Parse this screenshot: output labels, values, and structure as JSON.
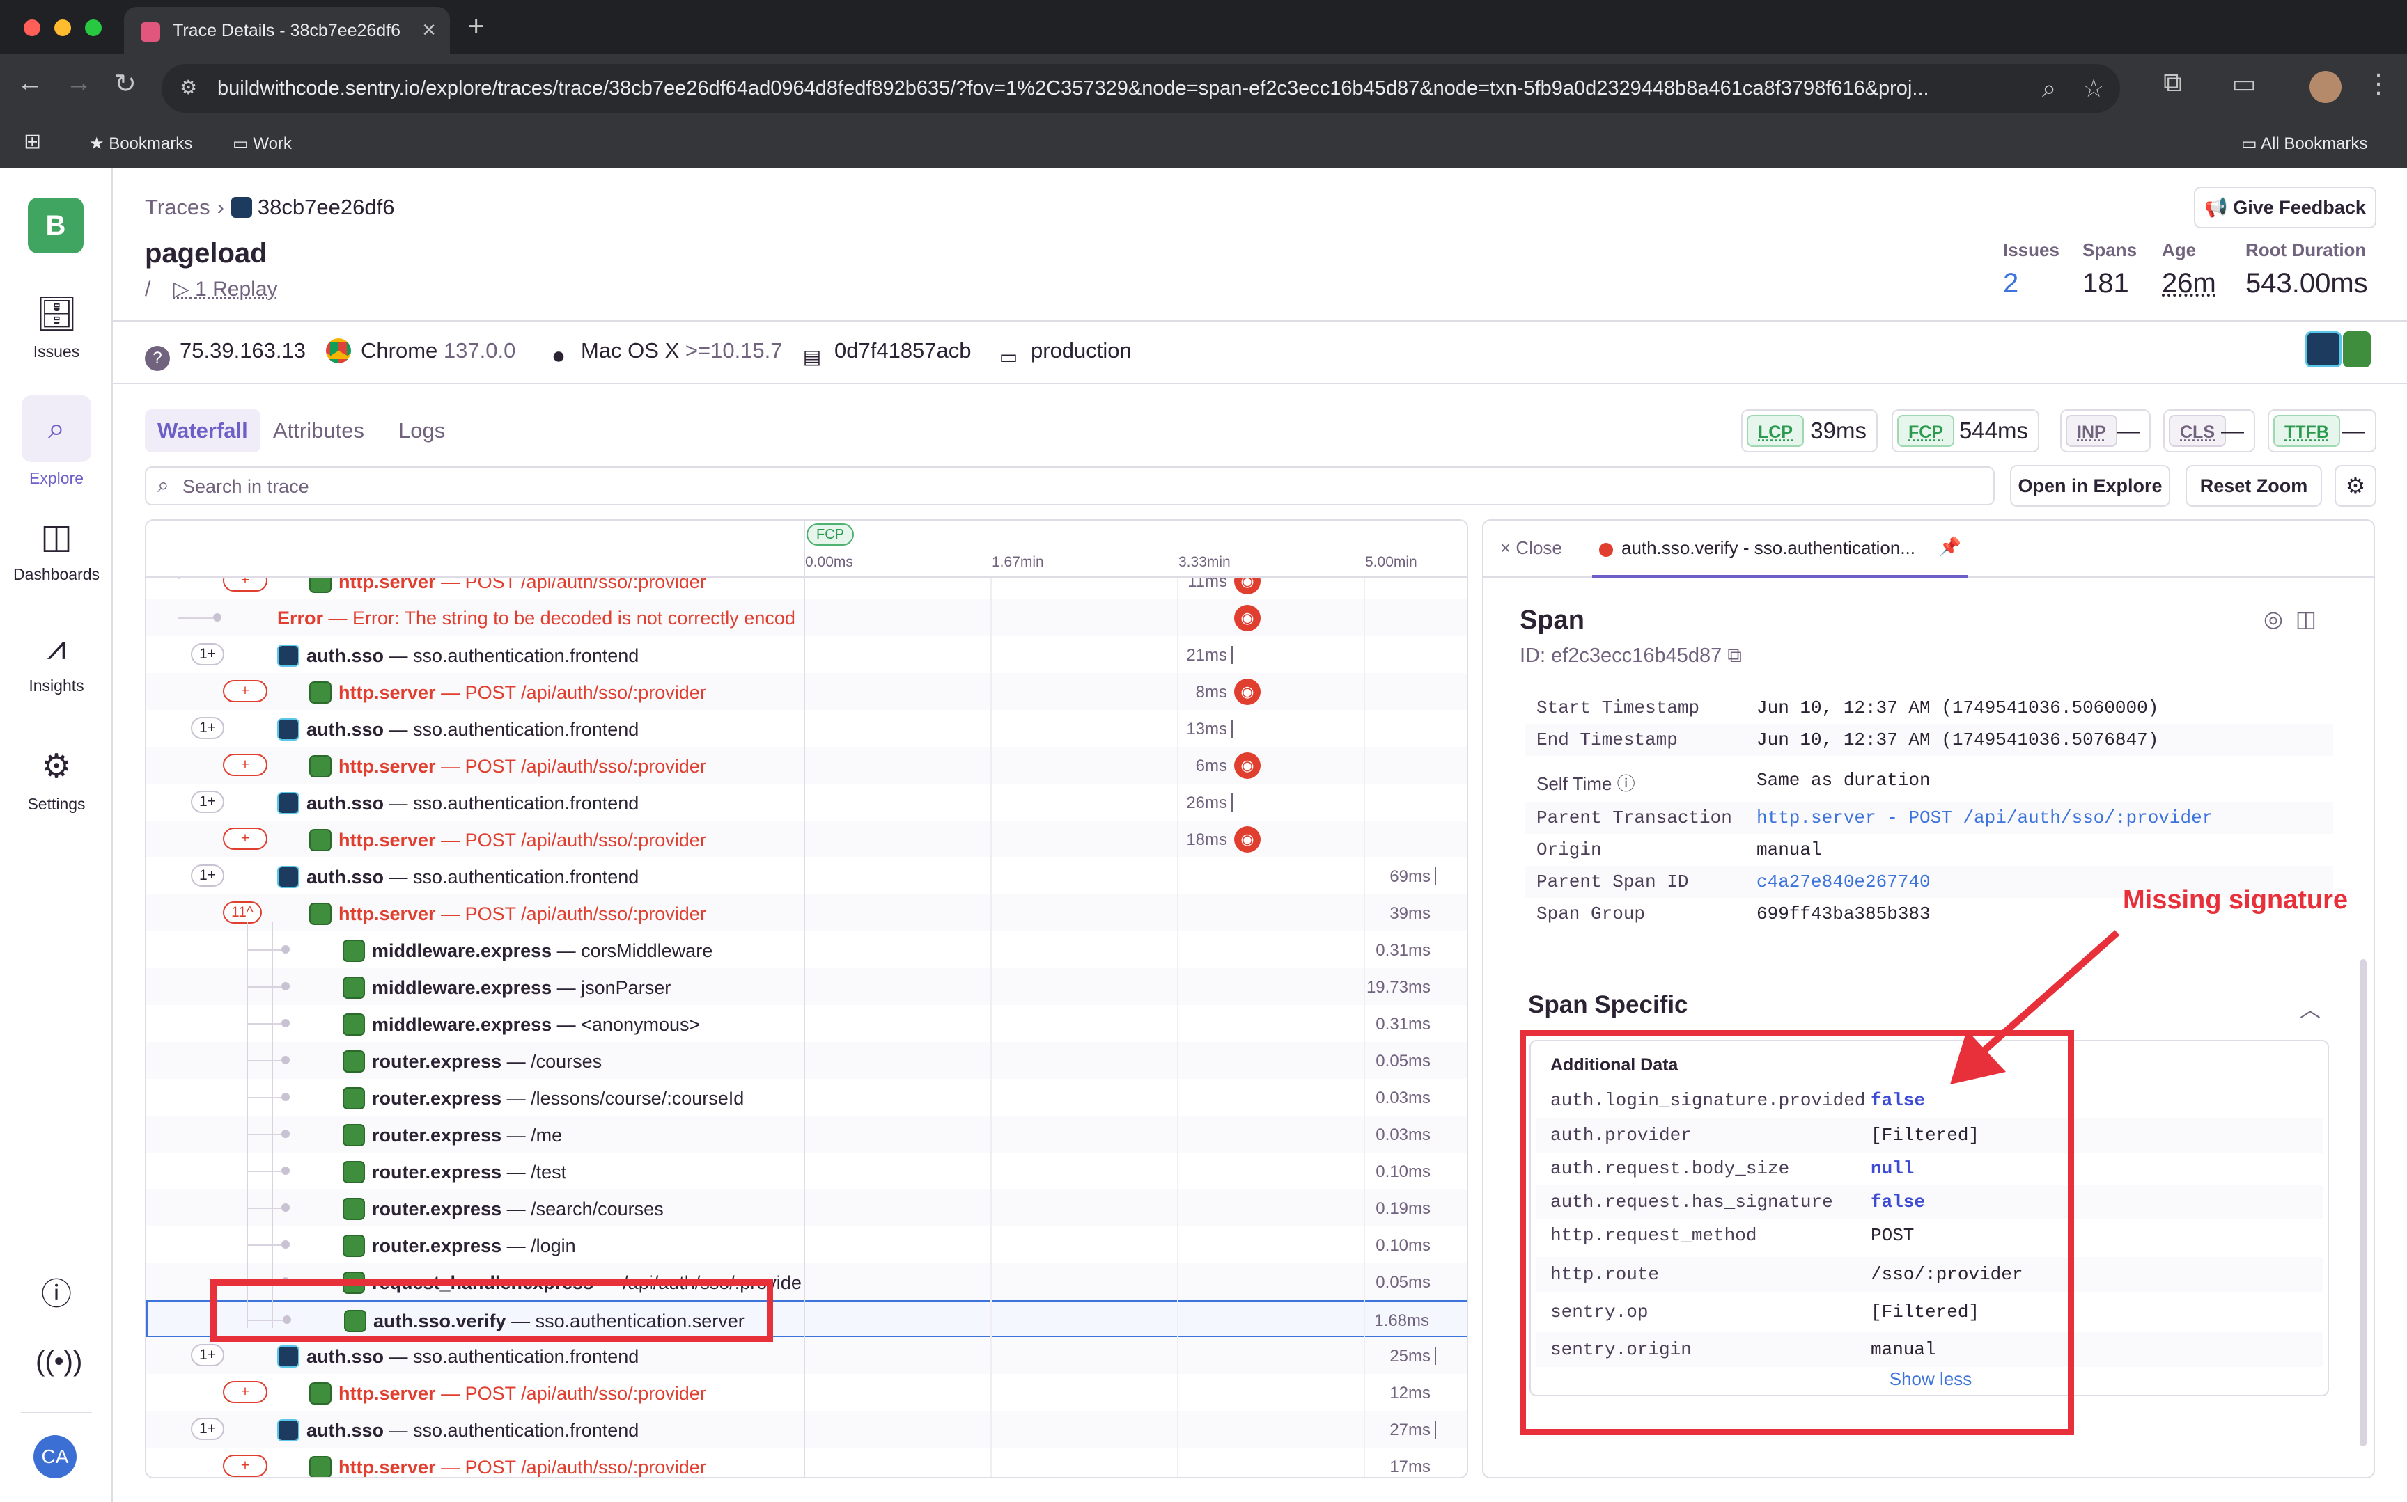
{
  "browser": {
    "tab_title": "Trace Details - 38cb7ee26df6",
    "url": "buildwithcode.sentry.io/explore/traces/trace/38cb7ee26df64ad0964d8fedf892b635/?fov=1%2C357329&node=span-ef2c3ecc16b45d87&node=txn-5fb9a0d2329448b8a461ca8f3798f616&proj...",
    "bookmarks": [
      "Bookmarks",
      "Work"
    ],
    "all_bookmarks": "All Bookmarks"
  },
  "sidebar": {
    "org_initial": "B",
    "items": [
      {
        "label": "Issues",
        "icon": "inbox-icon"
      },
      {
        "label": "Explore",
        "icon": "search-icon"
      },
      {
        "label": "Dashboards",
        "icon": "dashboard-icon"
      },
      {
        "label": "Insights",
        "icon": "graph-icon"
      },
      {
        "label": "Settings",
        "icon": "gear-icon"
      }
    ],
    "avatar": "CA"
  },
  "header": {
    "breadcrumb": [
      "Traces",
      "38cb7ee26df6"
    ],
    "give_feedback": "Give Feedback",
    "title": "pageload",
    "path": "/",
    "replay": "1 Replay",
    "stats": [
      {
        "label": "Issues",
        "value": "2"
      },
      {
        "label": "Spans",
        "value": "181"
      },
      {
        "label": "Age",
        "value": "26m"
      },
      {
        "label": "Root Duration",
        "value": "543.00ms"
      }
    ]
  },
  "meta": {
    "ip": "75.39.163.13",
    "browser": "Chrome",
    "browser_version": "137.0.0",
    "os": "Mac OS X",
    "os_version": ">=10.15.7",
    "release": "0d7f41857acb",
    "environment": "production"
  },
  "tabs": [
    "Waterfall",
    "Attributes",
    "Logs"
  ],
  "vitals": [
    {
      "name": "LCP",
      "value": "39ms",
      "state": "good"
    },
    {
      "name": "FCP",
      "value": "544ms",
      "state": "good"
    },
    {
      "name": "INP",
      "value": "—",
      "state": "none"
    },
    {
      "name": "CLS",
      "value": "—",
      "state": "none"
    },
    {
      "name": "TTFB",
      "value": "—",
      "state": "good"
    }
  ],
  "search": {
    "placeholder": "Search in trace"
  },
  "buttons": {
    "open_in_explore": "Open in Explore",
    "reset_zoom": "Reset Zoom"
  },
  "waterfall": {
    "fcp_tag": "FCP",
    "ticks": [
      "0.00ms",
      "1.67min",
      "3.33min",
      "5.00min"
    ],
    "rows": [
      {
        "op": "http.server",
        "desc": "POST /api/auth/sso/:provider",
        "kind": "err-partial",
        "dur": "11ms"
      },
      {
        "op": "Error",
        "desc": "Error: The string to be decoded is not correctly encod",
        "kind": "error",
        "dur": ""
      },
      {
        "op": "auth.sso",
        "desc": "sso.authentication.frontend",
        "kind": "fe",
        "count": "1",
        "dur": "21ms"
      },
      {
        "op": "http.server",
        "desc": "POST /api/auth/sso/:provider",
        "kind": "be-err",
        "dur": "8ms"
      },
      {
        "op": "auth.sso",
        "desc": "sso.authentication.frontend",
        "kind": "fe",
        "count": "1",
        "dur": "13ms"
      },
      {
        "op": "http.server",
        "desc": "POST /api/auth/sso/:provider",
        "kind": "be-err",
        "dur": "6ms"
      },
      {
        "op": "auth.sso",
        "desc": "sso.authentication.frontend",
        "kind": "fe",
        "count": "1",
        "dur": "26ms"
      },
      {
        "op": "http.server",
        "desc": "POST /api/auth/sso/:provider",
        "kind": "be-err",
        "dur": "18ms"
      },
      {
        "op": "auth.sso",
        "desc": "sso.authentication.frontend",
        "kind": "fe",
        "count": "1",
        "dur": "69ms"
      },
      {
        "op": "http.server",
        "desc": "POST /api/auth/sso/:provider",
        "kind": "be-err-open",
        "count": "11",
        "dur": "39ms"
      },
      {
        "op": "middleware.express",
        "desc": "corsMiddleware",
        "kind": "child",
        "dur": "0.31ms"
      },
      {
        "op": "middleware.express",
        "desc": "jsonParser",
        "kind": "child",
        "dur": "19.73ms"
      },
      {
        "op": "middleware.express",
        "desc": "<anonymous>",
        "kind": "child",
        "dur": "0.31ms"
      },
      {
        "op": "router.express",
        "desc": "/courses",
        "kind": "child",
        "dur": "0.05ms"
      },
      {
        "op": "router.express",
        "desc": "/lessons/course/:courseId",
        "kind": "child",
        "dur": "0.03ms"
      },
      {
        "op": "router.express",
        "desc": "/me",
        "kind": "child",
        "dur": "0.03ms"
      },
      {
        "op": "router.express",
        "desc": "/test",
        "kind": "child",
        "dur": "0.10ms"
      },
      {
        "op": "router.express",
        "desc": "/search/courses",
        "kind": "child",
        "dur": "0.19ms"
      },
      {
        "op": "router.express",
        "desc": "/login",
        "kind": "child",
        "dur": "0.10ms"
      },
      {
        "op": "request_handler.express",
        "desc": "/api/auth/sso/:provider",
        "kind": "child",
        "dur": "0.05ms"
      },
      {
        "op": "auth.sso.verify",
        "desc": "sso.authentication.server",
        "kind": "child-sel",
        "dur": "1.68ms"
      },
      {
        "op": "auth.sso",
        "desc": "sso.authentication.frontend",
        "kind": "fe",
        "count": "1",
        "dur": "25ms"
      },
      {
        "op": "http.server",
        "desc": "POST /api/auth/sso/:provider",
        "kind": "be-err",
        "dur": "12ms"
      },
      {
        "op": "auth.sso",
        "desc": "sso.authentication.frontend",
        "kind": "fe",
        "count": "1",
        "dur": "27ms"
      },
      {
        "op": "http.server",
        "desc": "POST /api/auth/sso/:provider",
        "kind": "be-err",
        "dur": "17ms"
      }
    ]
  },
  "detail": {
    "close": "Close",
    "tab_label": "auth.sso.verify - sso.authentication...",
    "title": "Span",
    "id": "ID: ef2c3ecc16b45d87",
    "fields": [
      {
        "k": "Start Timestamp",
        "v": "Jun 10, 12:37 AM (1749541036.5060000)"
      },
      {
        "k": "End Timestamp",
        "v": "Jun 10, 12:37 AM (1749541036.5076847)"
      },
      {
        "k": "Self Time",
        "v": "Same as duration"
      },
      {
        "k": "Parent Transaction",
        "v": "http.server - POST /api/auth/sso/:provider",
        "link": true
      },
      {
        "k": "Origin",
        "v": "manual"
      },
      {
        "k": "Parent Span ID",
        "v": "c4a27e840e267740",
        "link": true
      },
      {
        "k": "Span Group",
        "v": "699ff43ba385b383"
      }
    ],
    "section_title": "Span Specific",
    "additional_data_title": "Additional Data",
    "additional_data": [
      {
        "k": "auth.login_signature.provided",
        "v": "false",
        "kw": true
      },
      {
        "k": "auth.provider",
        "v": "[Filtered]"
      },
      {
        "k": "auth.request.body_size",
        "v": "null",
        "kw": true
      },
      {
        "k": "auth.request.has_signature",
        "v": "false",
        "kw": true
      },
      {
        "k": "http.request_method",
        "v": "POST"
      },
      {
        "k": "http.route",
        "v": "/sso/:provider"
      },
      {
        "k": "sentry.op",
        "v": "[Filtered]"
      },
      {
        "k": "sentry.origin",
        "v": "manual"
      }
    ],
    "show_less": "Show less"
  },
  "annotation": {
    "label": "Missing signature",
    "color": "#e8303a"
  }
}
